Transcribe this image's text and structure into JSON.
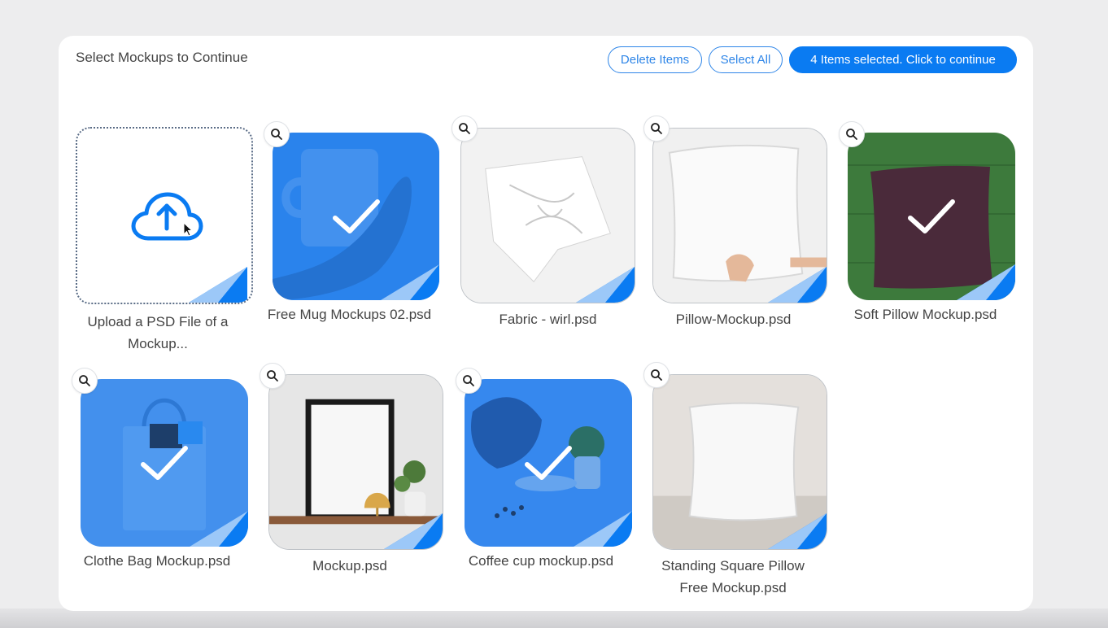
{
  "header": {
    "title": "Select Mockups to Continue",
    "delete_label": "Delete Items",
    "select_all_label": "Select All",
    "continue_label": "4 Items selected. Click to continue"
  },
  "colors": {
    "accent": "#0a7bf2",
    "selection_overlay": "#2680eb",
    "fold_dark": "#0a7bf2",
    "fold_light": "#8ec0f7"
  },
  "upload": {
    "caption": "Upload a PSD File of a Mockup...",
    "icon": "cloud-upload-icon"
  },
  "mockups": [
    {
      "name": "Free Mug Mockups 02.psd",
      "selected": true
    },
    {
      "name": "Fabric - wirl.psd",
      "selected": false
    },
    {
      "name": "Pillow-Mockup.psd",
      "selected": false
    },
    {
      "name": "Soft Pillow Mockup.psd",
      "selected": true
    },
    {
      "name": "Clothe Bag Mockup.psd",
      "selected": true
    },
    {
      "name": "Mockup.psd",
      "selected": false
    },
    {
      "name": "Coffee cup mockup.psd",
      "selected": true
    },
    {
      "name": "Standing Square Pillow Free Mockup.psd",
      "selected": false
    }
  ]
}
